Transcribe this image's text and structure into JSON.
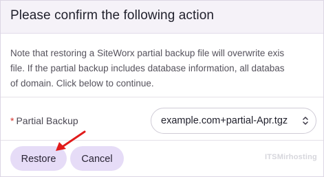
{
  "dialog": {
    "title": "Please confirm the following action",
    "notice_lines": [
      "Note that restoring a SiteWorx partial backup file will overwrite exis",
      "file. If the partial backup includes database information, all databas",
      "of domain. Click below to continue."
    ]
  },
  "form": {
    "required_marker": "*",
    "partial_backup_label": "Partial Backup",
    "partial_backup_value": "example.com+partial-Apr.tgz"
  },
  "actions": {
    "restore_label": "Restore",
    "cancel_label": "Cancel"
  },
  "watermark": "ITSMirhosting",
  "colors": {
    "header_bg": "#f5f2f8",
    "button_bg": "#e6dcf7",
    "required_marker": "#d4322c",
    "annotation_arrow": "#e11b1b"
  },
  "icons": {
    "select_caret": "updown-chevron-icon",
    "annotation": "red-arrow-icon"
  }
}
